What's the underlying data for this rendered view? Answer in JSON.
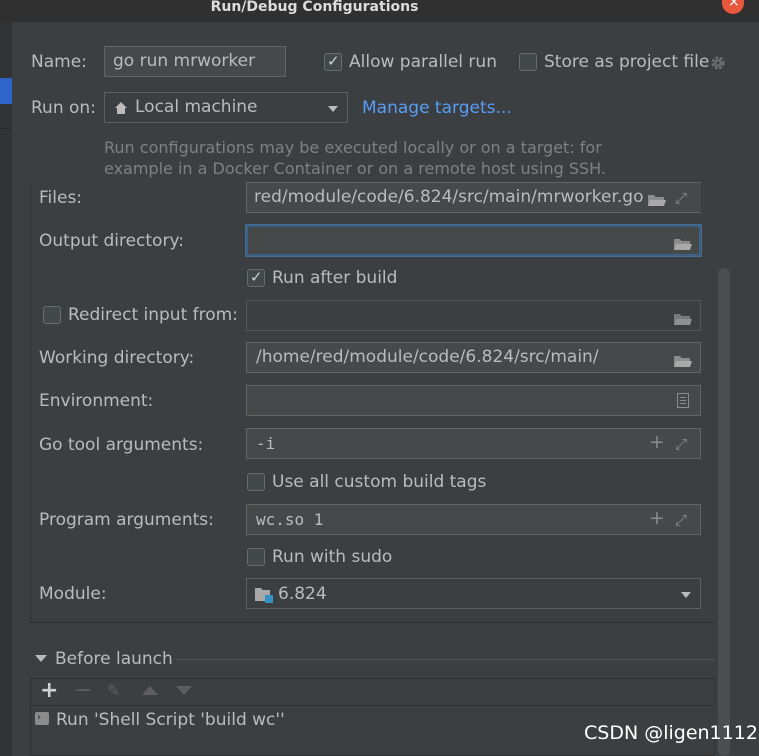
{
  "window": {
    "title": "Run/Debug Configurations"
  },
  "name_row": {
    "label": "Name:",
    "value": "go run mrworker",
    "allow_parallel_label": "Allow parallel run",
    "allow_parallel_checked": true,
    "store_project_label": "Store as project file",
    "store_project_checked": false
  },
  "run_on": {
    "label": "Run on:",
    "selected": "Local machine",
    "manage_targets": "Manage targets...",
    "hint_line1": "Run configurations may be executed locally or on a target: for",
    "hint_line2": "example in a Docker Container or on a remote host using SSH."
  },
  "form": {
    "files_label": "Files:",
    "files_value": "red/module/code/6.824/src/main/mrworker.go",
    "output_dir_label": "Output directory:",
    "output_dir_value": "",
    "run_after_build_label": "Run after build",
    "run_after_build_checked": true,
    "redirect_label": "Redirect input from:",
    "redirect_checked": false,
    "redirect_value": "",
    "working_dir_label": "Working directory:",
    "working_dir_value": "/home/red/module/code/6.824/src/main/",
    "environment_label": "Environment:",
    "environment_value": "",
    "go_tool_args_label": "Go tool arguments:",
    "go_tool_args_value": "-i",
    "custom_tags_label": "Use all custom build tags",
    "custom_tags_checked": false,
    "program_args_label": "Program arguments:",
    "program_args_value": "wc.so 1",
    "sudo_label": "Run with sudo",
    "sudo_checked": false,
    "module_label": "Module:",
    "module_value": "6.824"
  },
  "before_launch": {
    "title": "Before launch",
    "tasks": [
      "Run 'Shell Script 'build wc''"
    ]
  },
  "watermark": "CSDN @ligen1112",
  "colors": {
    "accent": "#589df6",
    "selection": "#2f65ca",
    "close": "#e9573f"
  }
}
